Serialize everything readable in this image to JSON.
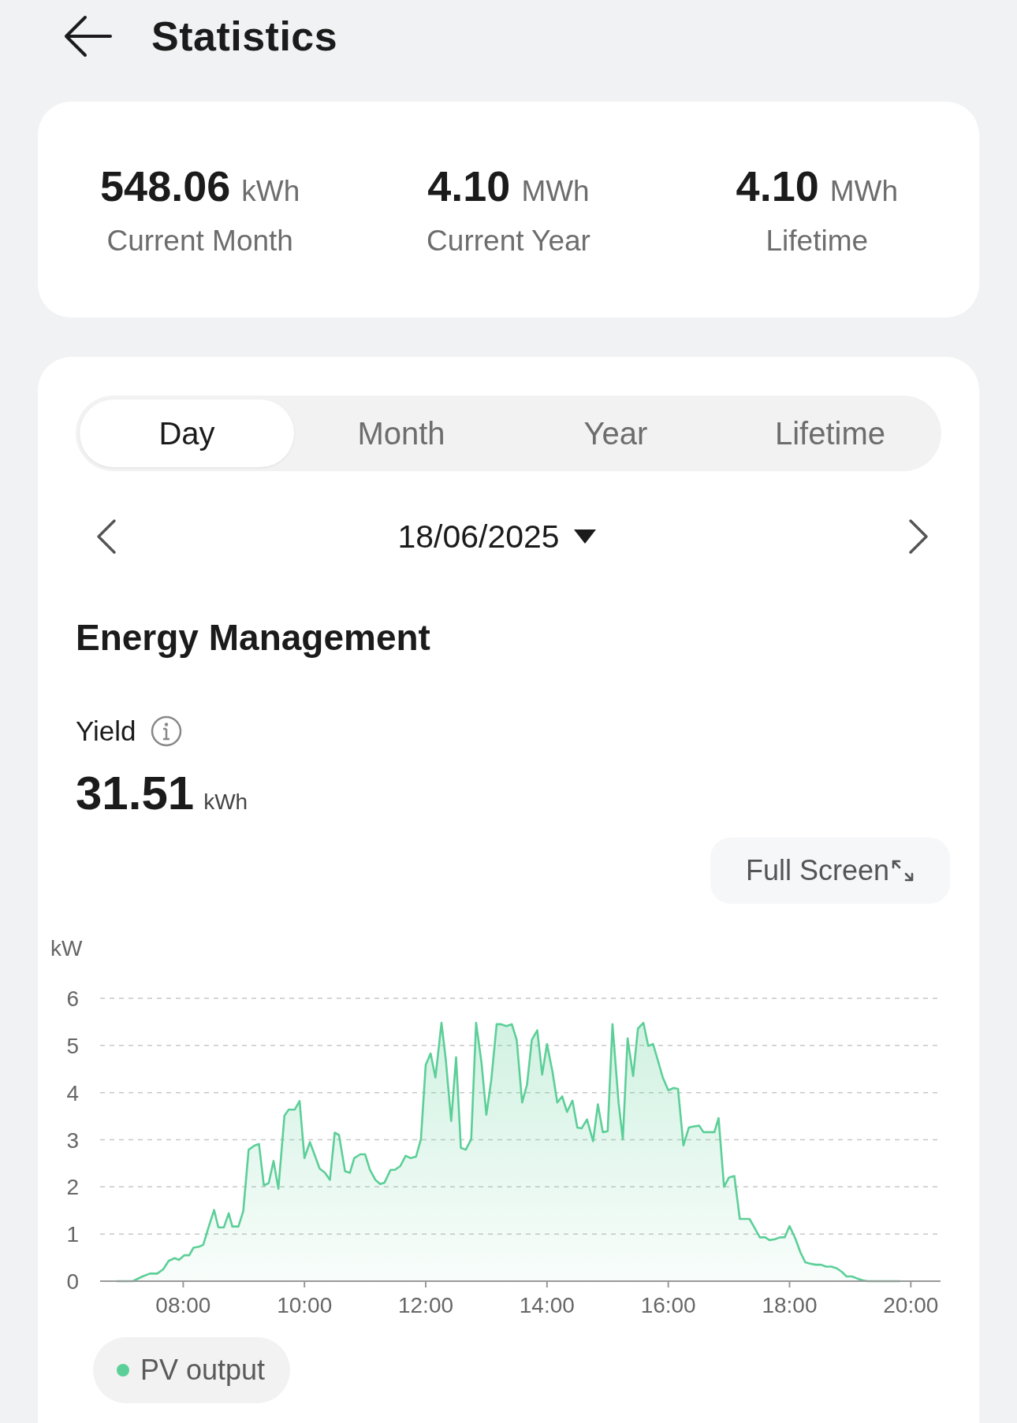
{
  "header": {
    "title": "Statistics"
  },
  "summary": [
    {
      "value": "548.06",
      "unit": "kWh",
      "label": "Current Month"
    },
    {
      "value": "4.10",
      "unit": "MWh",
      "label": "Current Year"
    },
    {
      "value": "4.10",
      "unit": "MWh",
      "label": "Lifetime"
    }
  ],
  "period_tabs": [
    {
      "label": "Day",
      "selected": true
    },
    {
      "label": "Month",
      "selected": false
    },
    {
      "label": "Year",
      "selected": false
    },
    {
      "label": "Lifetime",
      "selected": false
    }
  ],
  "date_selector": {
    "date": "18/06/2025"
  },
  "section_title": "Energy Management",
  "yield": {
    "label": "Yield",
    "value": "31.51",
    "unit": "kWh"
  },
  "full_screen_button": {
    "label": "Full Screen"
  },
  "chart": {
    "chart_data": {
      "type": "area",
      "grid": true,
      "ylabel": "kW",
      "xlim": [
        6.63,
        20.49
      ],
      "ylim": [
        0,
        6
      ],
      "xticks": [
        {
          "value": 8,
          "label": "08:00"
        },
        {
          "value": 10,
          "label": "10:00"
        },
        {
          "value": 12,
          "label": "12:00"
        },
        {
          "value": 14,
          "label": "14:00"
        },
        {
          "value": 16,
          "label": "16:00"
        },
        {
          "value": 18,
          "label": "18:00"
        },
        {
          "value": 20,
          "label": "20:00"
        }
      ],
      "yticks": [
        0,
        1,
        2,
        3,
        4,
        5,
        6
      ],
      "x": [
        6.9,
        7.17,
        7.33,
        7.45,
        7.57,
        7.67,
        7.76,
        7.86,
        7.93,
        8.02,
        8.1,
        8.17,
        8.26,
        8.33,
        8.41,
        8.51,
        8.58,
        8.67,
        8.75,
        8.81,
        8.91,
        8.99,
        9.08,
        9.18,
        9.25,
        9.33,
        9.41,
        9.49,
        9.57,
        9.67,
        9.74,
        9.84,
        9.92,
        10.0,
        10.09,
        10.17,
        10.25,
        10.34,
        10.42,
        10.5,
        10.57,
        10.67,
        10.75,
        10.82,
        10.92,
        11.0,
        11.08,
        11.17,
        11.25,
        11.32,
        11.42,
        11.49,
        11.58,
        11.67,
        11.75,
        11.84,
        11.92,
        12.0,
        12.08,
        12.16,
        12.26,
        12.33,
        12.42,
        12.5,
        12.58,
        12.66,
        12.75,
        12.83,
        12.92,
        13.0,
        13.08,
        13.17,
        13.24,
        13.33,
        13.42,
        13.5,
        13.59,
        13.67,
        13.75,
        13.84,
        13.92,
        14.0,
        14.09,
        14.17,
        14.25,
        14.33,
        14.42,
        14.5,
        14.57,
        14.66,
        14.76,
        14.84,
        14.92,
        15.0,
        15.08,
        15.18,
        15.25,
        15.33,
        15.42,
        15.5,
        15.59,
        15.67,
        15.75,
        15.84,
        15.91,
        16.0,
        16.09,
        16.16,
        16.25,
        16.34,
        16.41,
        16.51,
        16.58,
        16.67,
        16.76,
        16.83,
        16.92,
        17.0,
        17.09,
        17.18,
        17.25,
        17.34,
        17.42,
        17.51,
        17.6,
        17.67,
        17.76,
        17.84,
        17.92,
        18.0,
        18.1,
        18.18,
        18.26,
        18.35,
        18.43,
        18.52,
        18.6,
        18.69,
        18.78,
        18.86,
        18.94,
        19.03,
        19.11,
        19.2,
        19.28,
        19.82
      ],
      "series": [
        {
          "name": "PV output",
          "color": "#5ccf98",
          "values": [
            0,
            0,
            0.1,
            0.16,
            0.16,
            0.25,
            0.43,
            0.49,
            0.45,
            0.55,
            0.55,
            0.71,
            0.73,
            0.77,
            1.11,
            1.51,
            1.14,
            1.14,
            1.44,
            1.16,
            1.16,
            1.48,
            2.79,
            2.88,
            2.91,
            2.03,
            2.08,
            2.55,
            1.96,
            3.51,
            3.64,
            3.64,
            3.82,
            2.61,
            2.95,
            2.67,
            2.39,
            2.3,
            2.15,
            3.15,
            3.1,
            2.33,
            2.3,
            2.61,
            2.69,
            2.69,
            2.36,
            2.15,
            2.06,
            2.09,
            2.36,
            2.36,
            2.44,
            2.66,
            2.61,
            2.64,
            3.01,
            4.59,
            4.83,
            4.32,
            5.48,
            4.71,
            3.4,
            4.75,
            2.83,
            2.79,
            3.01,
            5.48,
            4.63,
            3.53,
            4.26,
            5.45,
            5.45,
            5.41,
            5.45,
            5.12,
            3.79,
            4.17,
            5.12,
            5.32,
            4.38,
            5.03,
            4.44,
            3.79,
            3.92,
            3.59,
            3.83,
            3.26,
            3.24,
            3.43,
            2.97,
            3.75,
            3.16,
            3.18,
            5.45,
            3.79,
            3.01,
            5.15,
            4.35,
            5.36,
            5.48,
            4.99,
            5.03,
            4.63,
            4.32,
            4.05,
            4.1,
            4.08,
            2.88,
            3.26,
            3.28,
            3.3,
            3.16,
            3.16,
            3.16,
            3.46,
            2.0,
            2.2,
            2.23,
            1.32,
            1.32,
            1.32,
            1.14,
            0.93,
            0.93,
            0.87,
            0.89,
            0.93,
            0.93,
            1.17,
            0.89,
            0.61,
            0.4,
            0.37,
            0.35,
            0.35,
            0.31,
            0.31,
            0.27,
            0.2,
            0.1,
            0.1,
            0.06,
            0.02,
            0,
            0
          ]
        }
      ]
    }
  }
}
